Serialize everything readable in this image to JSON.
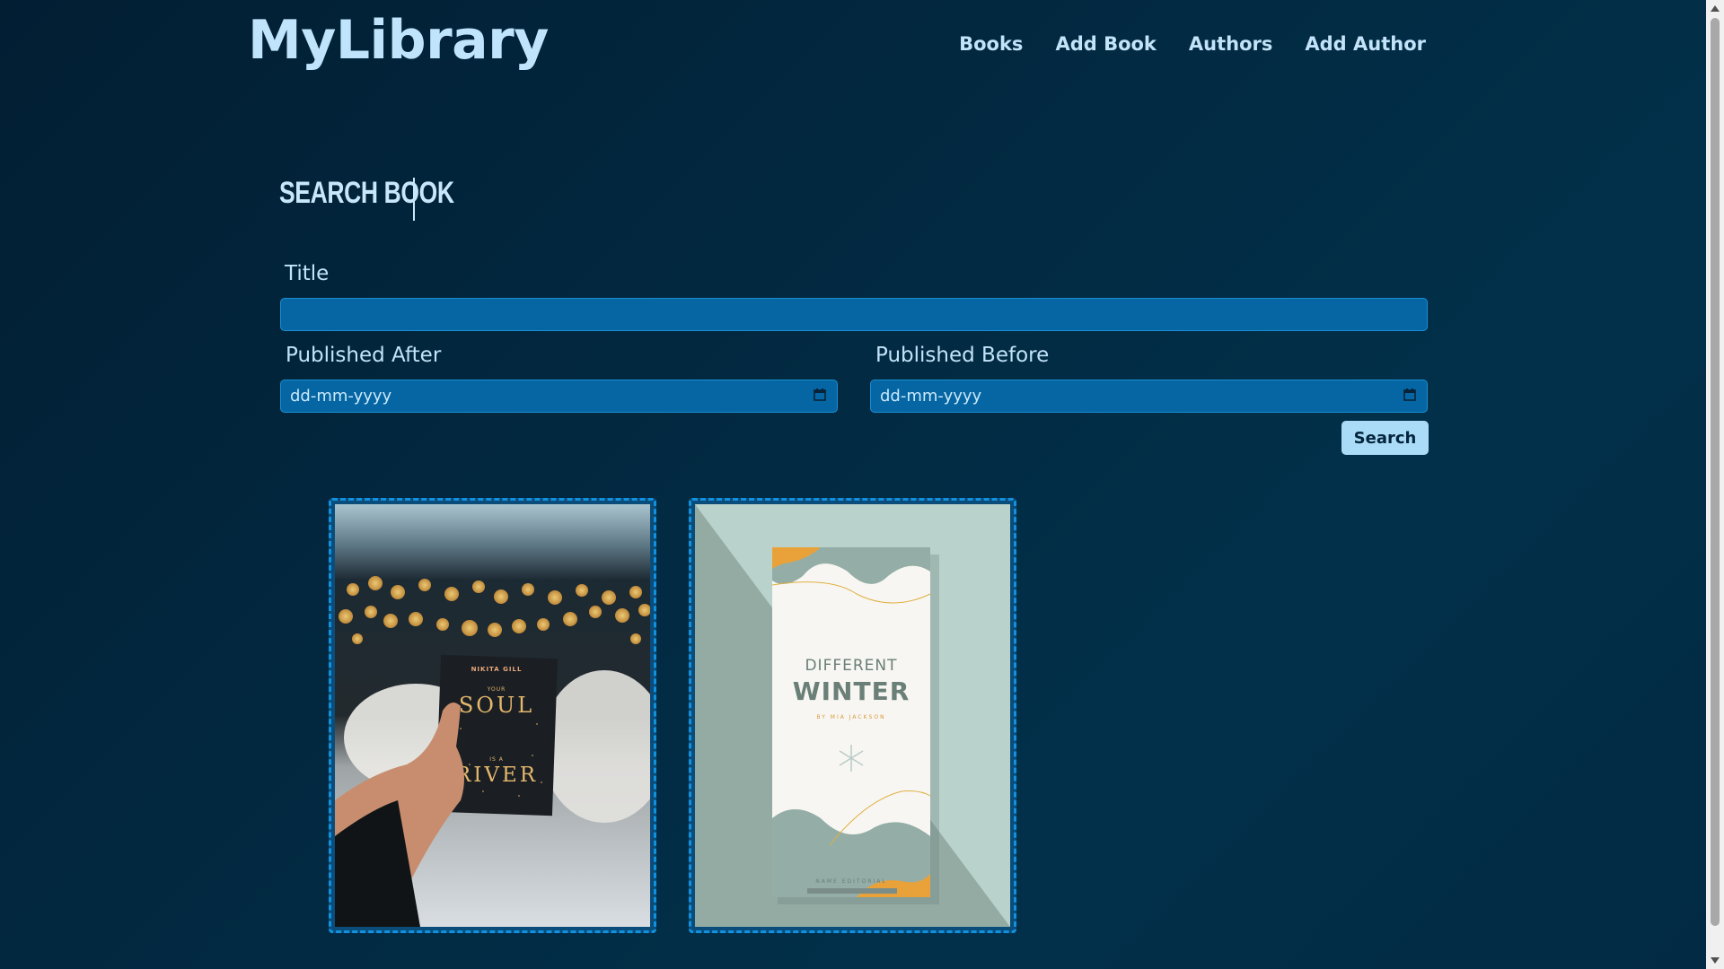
{
  "header": {
    "brand": "MyLibrary",
    "nav": [
      "Books",
      "Add Book",
      "Authors",
      "Add Author"
    ]
  },
  "page": {
    "title": "SEARCH BOOK"
  },
  "form": {
    "title_label": "Title",
    "title_value": "",
    "published_after_label": "Published After",
    "published_after_placeholder": "dd-mm-yyyy",
    "published_before_label": "Published Before",
    "published_before_placeholder": "dd-mm-yyyy",
    "search_label": "Search"
  },
  "books": [
    {
      "cover_author": "NIKITA GILL",
      "cover_title_line1": "YOUR",
      "cover_title_line2": "SOUL",
      "cover_title_line3": "IS A",
      "cover_title_line4": "RIVER"
    },
    {
      "cover_title_line1": "DIFFERENT",
      "cover_title_line2": "WINTER",
      "cover_author": "BY MIA JACKSON",
      "cover_publisher": "NAME EDITORIAL"
    }
  ],
  "colors": {
    "background": "#022a42",
    "accent": "#0566a3",
    "button": "#aadcf7",
    "border": "#1191e0"
  },
  "icons": {
    "date": "calendar-icon"
  }
}
